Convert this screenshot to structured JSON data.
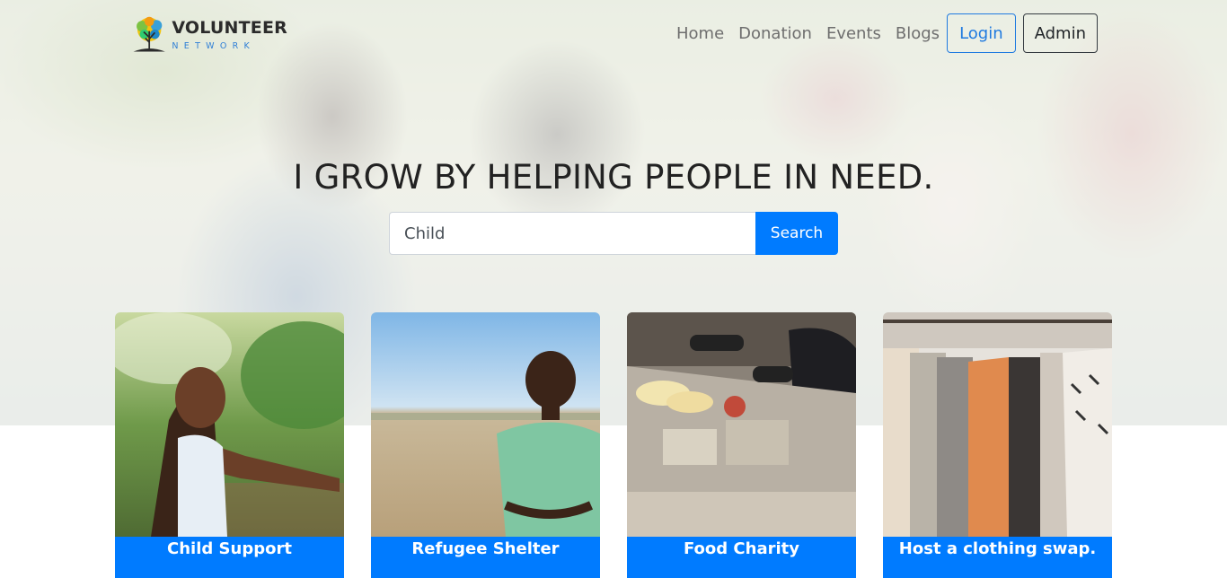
{
  "brand": {
    "name": "VOLUNTEER",
    "tagline": "NETWORK"
  },
  "nav": {
    "links": [
      "Home",
      "Donation",
      "Events",
      "Blogs"
    ],
    "login": "Login",
    "admin": "Admin"
  },
  "hero": {
    "headline": "I GROW BY HELPING PEOPLE IN NEED.",
    "search": {
      "value": "Child",
      "button": "Search"
    }
  },
  "cards": [
    {
      "title": "Child Support"
    },
    {
      "title": "Refugee Shelter"
    },
    {
      "title": "Food Charity"
    },
    {
      "title": "Host a clothing swap."
    }
  ],
  "colors": {
    "primary": "#007bff",
    "brand_blue": "#2f7fd6",
    "dark": "#212529"
  },
  "icons": {
    "logo": "tree-logo-icon"
  }
}
